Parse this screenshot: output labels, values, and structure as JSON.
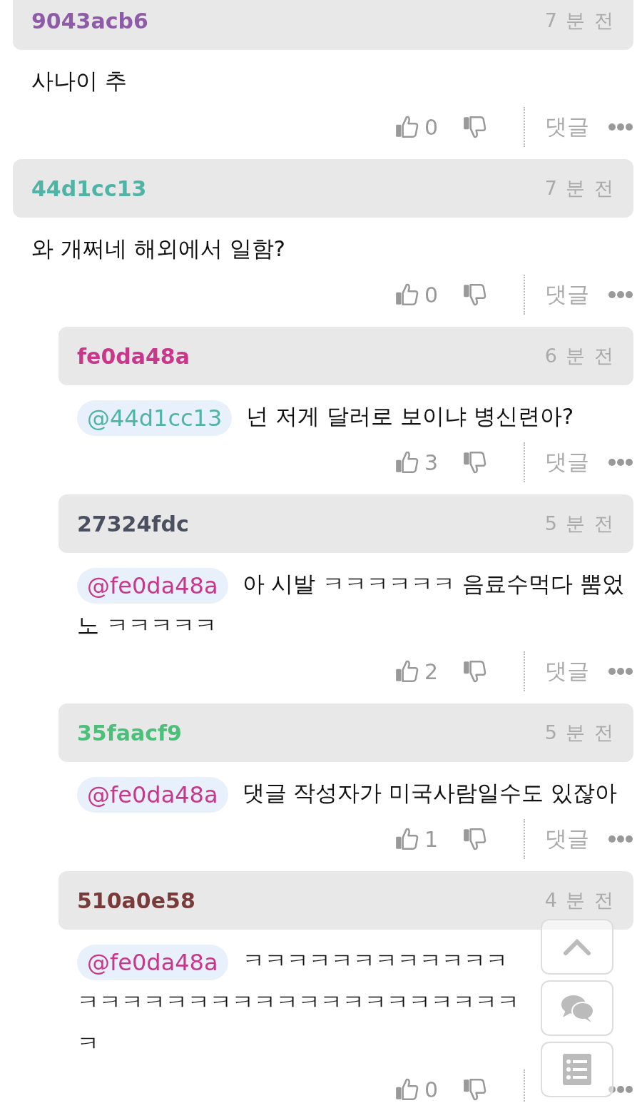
{
  "comments": [
    {
      "author": "9043acb6",
      "color": "#8e5ba8",
      "time": "7 분 전",
      "text": "사나이 추",
      "likes": "0",
      "reply_label": "댓글"
    },
    {
      "author": "44d1cc13",
      "color": "#4fb3a6",
      "time": "7 분 전",
      "text": "와 개쩌네 해외에서 일함?",
      "likes": "0",
      "reply_label": "댓글",
      "children": [
        {
          "author": "fe0da48a",
          "color": "#c8378a",
          "time": "6 분 전",
          "mention": {
            "text": "@44d1cc13",
            "color": "#4fb3a6"
          },
          "text": "넌 저게 달러로 보이냐 병신련아?",
          "likes": "3",
          "reply_label": "댓글"
        },
        {
          "author": "27324fdc",
          "color": "#4a5060",
          "time": "5 분 전",
          "mention": {
            "text": "@fe0da48a",
            "color": "#c8378a"
          },
          "text": "아 시발 ㅋㅋㅋㅋㅋㅋ 음료수먹다 뿜었노 ㅋㅋㅋㅋㅋ",
          "likes": "2",
          "reply_label": "댓글"
        },
        {
          "author": "35faacf9",
          "color": "#4cc07a",
          "time": "5 분 전",
          "mention": {
            "text": "@fe0da48a",
            "color": "#c8378a"
          },
          "text": "댓글 작성자가 미국사람일수도 있잖아",
          "likes": "1",
          "reply_label": "댓글"
        },
        {
          "author": "510a0e58",
          "color": "#7a3a3a",
          "time": "4 분 전",
          "mention": {
            "text": "@fe0da48a",
            "color": "#c8378a"
          },
          "text": "ㅋㅋㅋㅋㅋㅋㅋㅋㅋㅋㅋㅋㅋㅋㅋㅋㅋㅋㅋㅋㅋㅋㅋㅋㅋㅋㅋㅋㅋㅋㅋㅋㅋ",
          "likes": "0"
        }
      ]
    }
  ],
  "floating_buttons": [
    {
      "kind": "top"
    },
    {
      "kind": "comments"
    },
    {
      "kind": "list"
    }
  ]
}
